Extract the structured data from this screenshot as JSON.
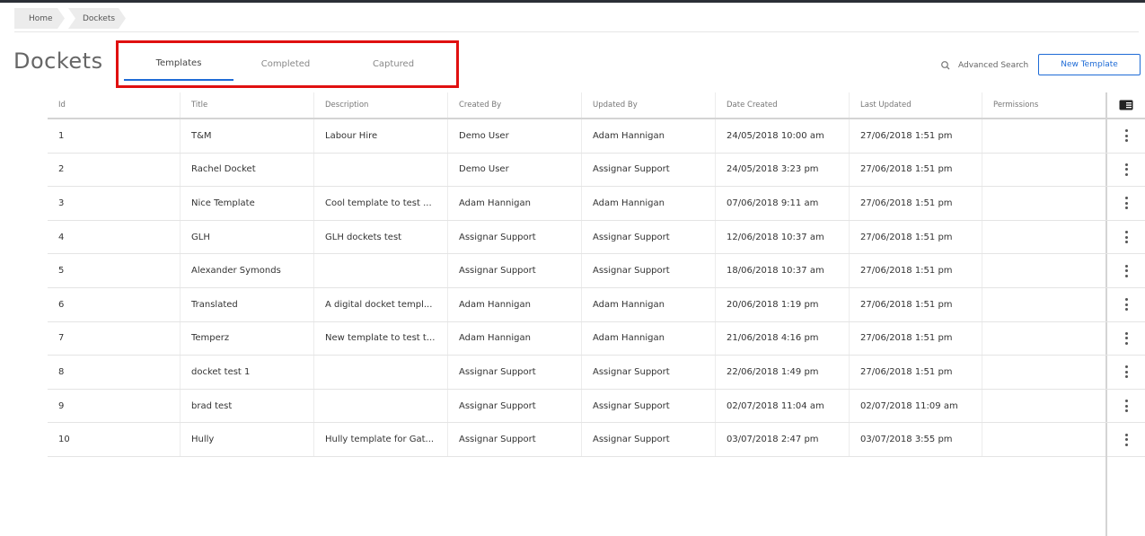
{
  "breadcrumb": [
    "Home",
    "Dockets"
  ],
  "page_title": "Dockets",
  "tabs": [
    {
      "label": "Templates",
      "active": true
    },
    {
      "label": "Completed",
      "active": false
    },
    {
      "label": "Captured",
      "active": false
    }
  ],
  "toolbar": {
    "advanced_search": "Advanced Search",
    "new_template": "New Template"
  },
  "colors": {
    "accent": "#1e6bd6",
    "highlight": "#e01010"
  },
  "table": {
    "columns": [
      "Id",
      "Title",
      "Description",
      "Created By",
      "Updated By",
      "Date Created",
      "Last Updated",
      "Permissions"
    ],
    "rows": [
      [
        "1",
        "T&M",
        "Labour Hire",
        "Demo User",
        "Adam Hannigan",
        "24/05/2018 10:00 am",
        "27/06/2018 1:51 pm",
        ""
      ],
      [
        "2",
        "Rachel Docket",
        "",
        "Demo User",
        "Assignar Support",
        "24/05/2018 3:23 pm",
        "27/06/2018 1:51 pm",
        ""
      ],
      [
        "3",
        "Nice Template",
        "Cool template to test ...",
        "Adam Hannigan",
        "Adam Hannigan",
        "07/06/2018 9:11 am",
        "27/06/2018 1:51 pm",
        ""
      ],
      [
        "4",
        "GLH",
        "GLH dockets test",
        "Assignar Support",
        "Assignar Support",
        "12/06/2018 10:37 am",
        "27/06/2018 1:51 pm",
        ""
      ],
      [
        "5",
        "Alexander Symonds",
        "",
        "Assignar Support",
        "Assignar Support",
        "18/06/2018 10:37 am",
        "27/06/2018 1:51 pm",
        ""
      ],
      [
        "6",
        "Translated",
        "A digital docket templ...",
        "Adam Hannigan",
        "Adam Hannigan",
        "20/06/2018 1:19 pm",
        "27/06/2018 1:51 pm",
        ""
      ],
      [
        "7",
        "Temperz",
        "New template to test t...",
        "Adam Hannigan",
        "Adam Hannigan",
        "21/06/2018 4:16 pm",
        "27/06/2018 1:51 pm",
        ""
      ],
      [
        "8",
        "docket test 1",
        "",
        "Assignar Support",
        "Assignar Support",
        "22/06/2018 1:49 pm",
        "27/06/2018 1:51 pm",
        ""
      ],
      [
        "9",
        "brad test",
        "",
        "Assignar Support",
        "Assignar Support",
        "02/07/2018 11:04 am",
        "02/07/2018 11:09 am",
        ""
      ],
      [
        "10",
        "Hully",
        "Hully template for Gat...",
        "Assignar Support",
        "Assignar Support",
        "03/07/2018 2:47 pm",
        "03/07/2018 3:55 pm",
        ""
      ]
    ],
    "row_action_icon": "more-vertical-icon",
    "column_selector_icon": "column-selector-icon"
  }
}
